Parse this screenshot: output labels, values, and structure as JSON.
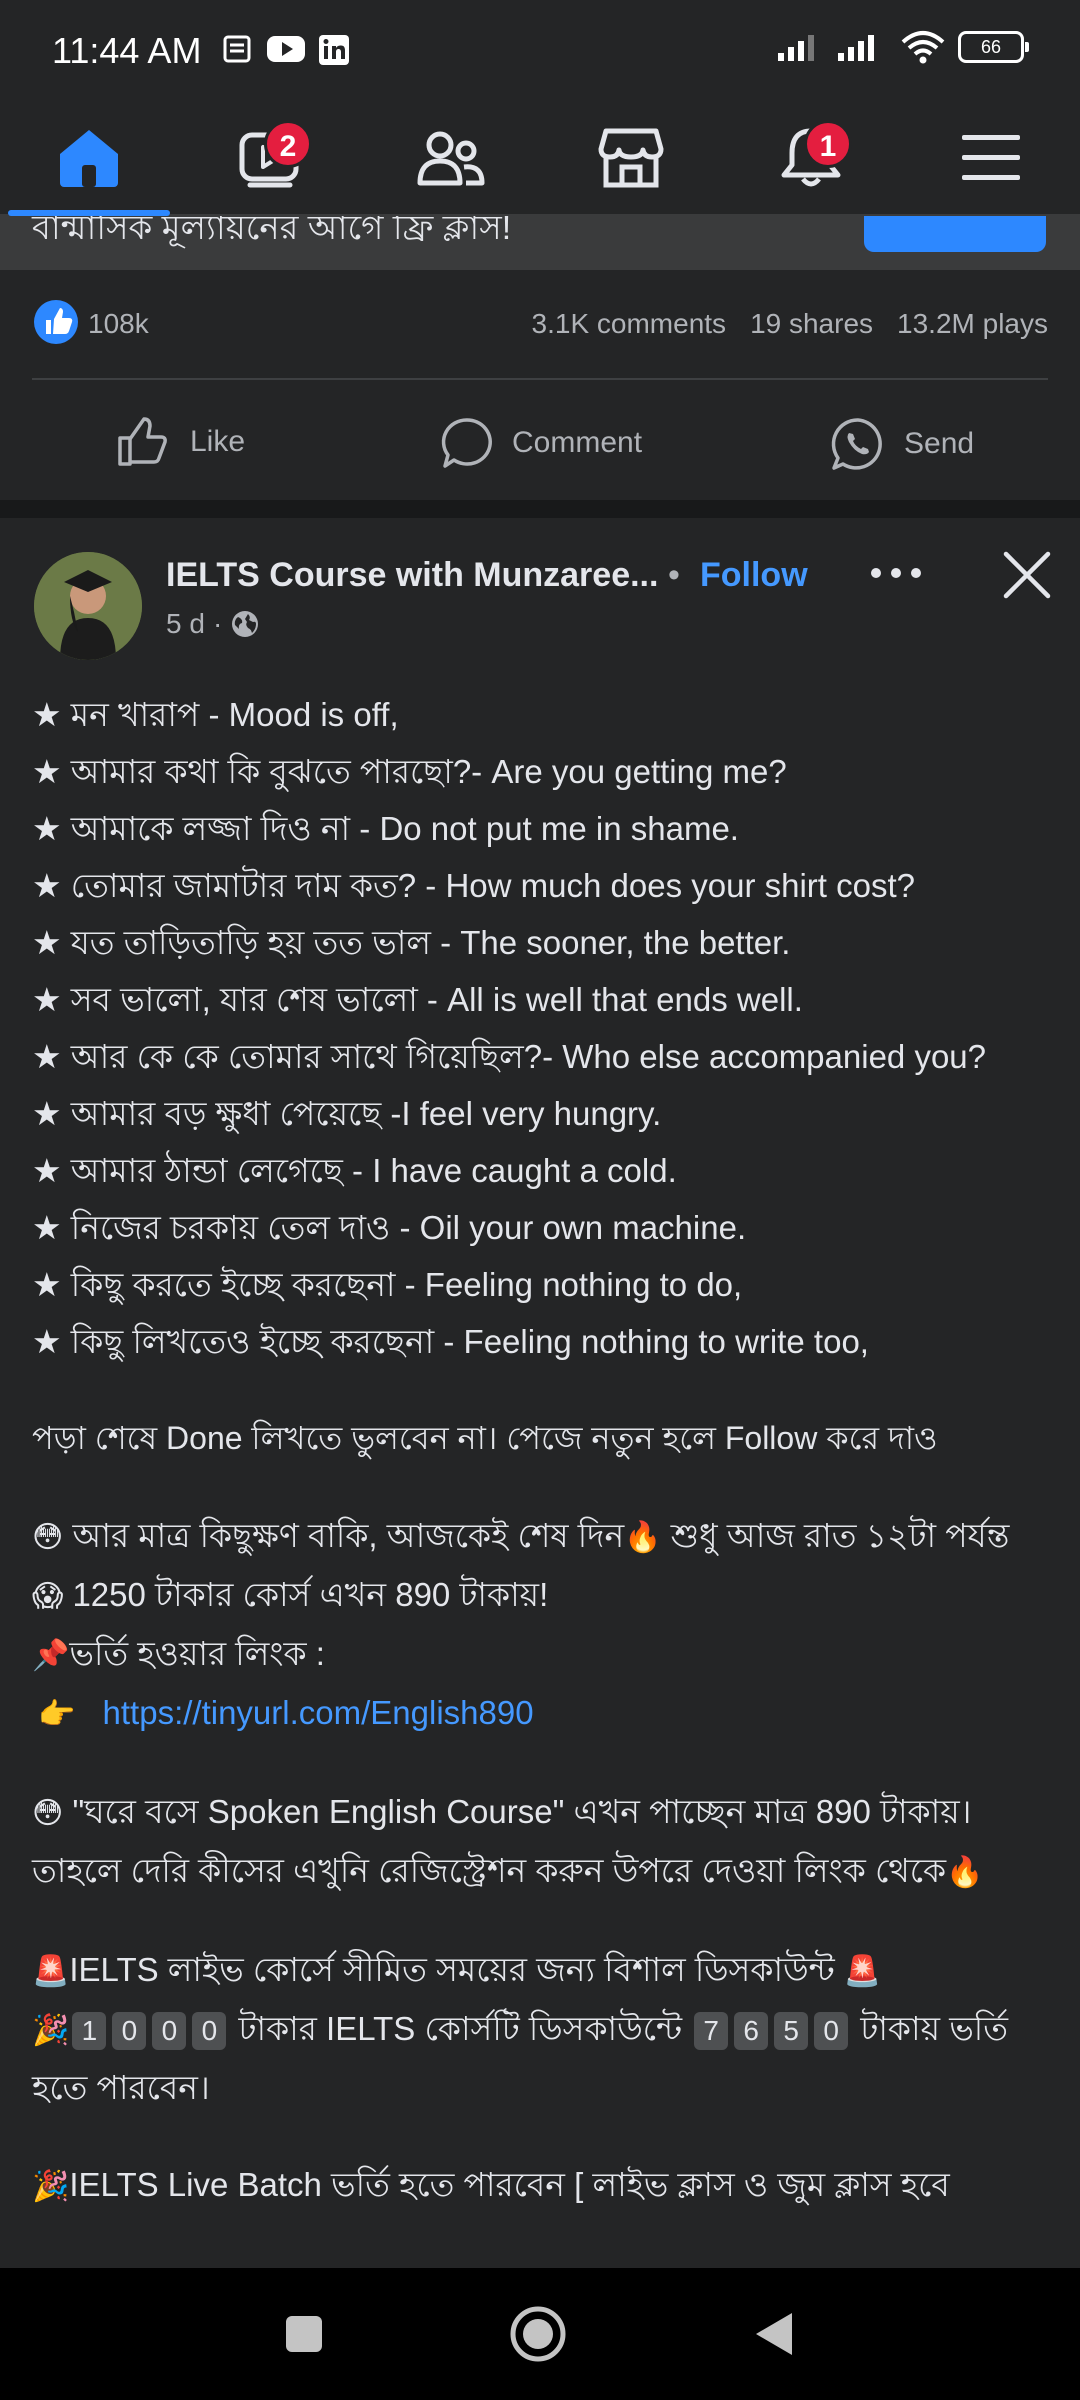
{
  "status_bar": {
    "time": "11:44 AM",
    "battery": "66",
    "icons": [
      "notes-icon",
      "youtube-icon",
      "linkedin-icon",
      "signal-icon",
      "signal-icon",
      "wifi-icon",
      "battery-icon"
    ]
  },
  "top_nav": {
    "items": [
      {
        "name": "home",
        "icon": "home-icon",
        "badge": ""
      },
      {
        "name": "video",
        "icon": "video-icon",
        "badge": "2"
      },
      {
        "name": "friends",
        "icon": "friends-icon",
        "badge": ""
      },
      {
        "name": "marketplace",
        "icon": "marketplace-icon",
        "badge": ""
      },
      {
        "name": "notifications",
        "icon": "bell-icon",
        "badge": "1"
      },
      {
        "name": "menu",
        "icon": "menu-icon",
        "badge": ""
      }
    ],
    "accent": "#2d88ff"
  },
  "prev_post": {
    "caption_fragment": "বান্মাসিক মূল্যায়নের আগে ফ্রি ক্লাস!",
    "reactions_count": "108k",
    "comments": "3.1K comments",
    "shares": "19 shares",
    "plays": "13.2M plays",
    "actions": {
      "like": "Like",
      "comment": "Comment",
      "send": "Send"
    }
  },
  "post": {
    "author": "IELTS Course with Munzaree...",
    "separator": "•",
    "follow_label": "Follow",
    "time": "5 d",
    "privacy_separator": "·",
    "body_lines": [
      "★ মন খারাপ - Mood is off,",
      "★ আমার কথা কি বুঝতে পারছো?- Are you getting me?",
      "★ আমাকে লজ্জা দিও না - Do not put me in shame.",
      "★ তোমার জামাটার দাম কত? - How much does your shirt cost?",
      "★ যত তাড়িতাড়ি হয় তত ভাল - The sooner, the better.",
      "★ সব ভালো, যার শেষ ভালো - All is well that ends well.",
      "★ আর কে কে তোমার সাথে গিয়েছিল?- Who else accompanied you?",
      "★ আমার বড় ক্ষুধা পেয়েছে -I feel very hungry.",
      "★ আমার ঠান্ডা লেগেছে - I have caught a cold.",
      "★ নিজের চরকায় তেল দাও - Oil your own machine.",
      "★ কিছু করতে ইচ্ছে করছেনা - Feeling nothing to do,",
      "★ কিছু লিখতেও ইচ্ছে করছেনা - Feeling nothing to write too,"
    ],
    "done_line": " পড়া শেষে Done লিখতে ভুলবেন না। পেজে নতুন হলে Follow করে দাও",
    "offer_line": "আর মাত্র কিছুক্ষণ বাকি, আজকেই শেষ দিন",
    "offer_line_2": "শুধু আজ রাত ১২টা পর্যন্ত",
    "offer_line_3": "1250 টাকার কোর্স এখন 890  টাকায়!",
    "admission_link_label": "ভর্তি হওয়ার লিংক :",
    "link_url": "https://tinyurl.com/English890",
    "spoken_line": "\"ঘরে বসে Spoken English Course\" এখন পাচ্ছেন মাত্র 890 টাকায়। তাহলে দেরি কীসের এখুনি রেজিস্ট্রেশন করুন উপরে দেওয়া লিংক থেকে",
    "ielts_live_line": "IELTS লাইভ কোর্সে সীমিত সময়ের জন্য বিশাল ডিসকাউন্ট",
    "price_old_digits": [
      "1",
      "0",
      "0",
      "0"
    ],
    "price_mid_text": "টাকার IELTS কোর্সটি ডিসকাউন্টে",
    "price_new_digits": [
      "7",
      "6",
      "5",
      "0"
    ],
    "price_tail": "টাকায় ভর্তি হতে পারবেন।",
    "batch_line": "IELTS Live Batch  ভর্তি হতে পারবেন [ লাইভ ক্লাস ও জুম ক্লাস হবে"
  },
  "system_nav": {
    "icons": [
      "recents-icon",
      "home-circle-icon",
      "back-icon"
    ]
  }
}
